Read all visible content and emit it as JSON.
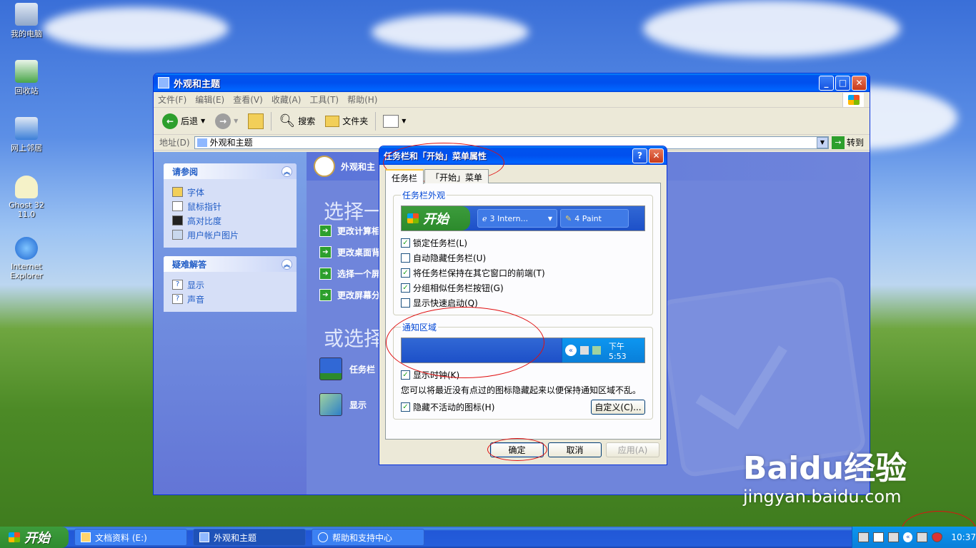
{
  "desktop": {
    "icons": [
      {
        "label": "我的电脑"
      },
      {
        "label": "回收站"
      },
      {
        "label": "网上邻居"
      },
      {
        "label": "Ghost 32 11.0"
      },
      {
        "label": "Internet Explorer"
      }
    ]
  },
  "explorer": {
    "title": "外观和主题",
    "menu": [
      "文件(F)",
      "编辑(E)",
      "查看(V)",
      "收藏(A)",
      "工具(T)",
      "帮助(H)"
    ],
    "toolbar": {
      "back": "后退",
      "search": "搜索",
      "folders": "文件夹"
    },
    "address": {
      "label": "地址(D)",
      "value": "外观和主题",
      "go": "转到"
    },
    "see_also": {
      "title": "请参阅",
      "items": [
        "字体",
        "鼠标指针",
        "高对比度",
        "用户帐户图片"
      ]
    },
    "troubleshoot": {
      "title": "疑难解答",
      "items": [
        "显示",
        "声音"
      ]
    },
    "header": "外观和主",
    "pick_task": "选择一",
    "tasks": [
      "更改计算相",
      "更改桌面背",
      "选择一个屏",
      "更改屏幕分"
    ],
    "pick_icon": "或选择",
    "icon_items": [
      "任务栏",
      "显示"
    ]
  },
  "dialog": {
    "title": "任务栏和「开始」菜单属性",
    "help": "?",
    "tabs": [
      "任务栏",
      "「开始」菜单"
    ],
    "appearance_legend": "任务栏外观",
    "preview": {
      "start": "开始",
      "item1": "3 Intern...",
      "item2": "4 Paint"
    },
    "options": [
      {
        "label": "锁定任务栏(L)",
        "checked": true
      },
      {
        "label": "自动隐藏任务栏(U)",
        "checked": false
      },
      {
        "label": "将任务栏保持在其它窗口的前端(T)",
        "checked": true
      },
      {
        "label": "分组相似任务栏按钮(G)",
        "checked": true
      },
      {
        "label": "显示快速启动(Q)",
        "checked": false
      }
    ],
    "notify_legend": "通知区域",
    "tray_time": "下午 5:53",
    "show_clock": {
      "label": "显示时钟(K)",
      "checked": true
    },
    "description": "您可以将最近没有点过的图标隐藏起来以便保持通知区域不乱。",
    "hide_inactive": {
      "label": "隐藏不活动的图标(H)",
      "checked": true
    },
    "customize": "自定义(C)...",
    "ok": "确定",
    "cancel": "取消",
    "apply": "应用(A)"
  },
  "taskbar": {
    "start": "开始",
    "items": [
      "文档资料 (E:)",
      "外观和主题",
      "帮助和支持中心"
    ],
    "clock": "10:37"
  },
  "watermark": {
    "brand": "Baidu经验",
    "url": "jingyan.baidu.com"
  },
  "colors": {
    "xp_blue": "#0053ee",
    "start_green": "#2f8b2f",
    "annotation_red": "#e01010"
  }
}
